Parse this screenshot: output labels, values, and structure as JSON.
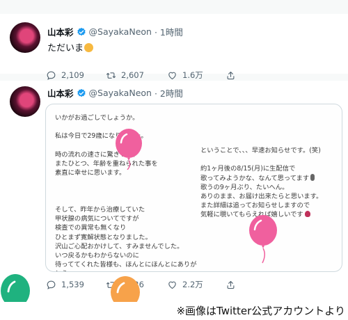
{
  "tweet1": {
    "name": "山本彩",
    "handle": "@SayakaNeon",
    "time": "· 1時間",
    "text": "ただいま",
    "emoji": "smiling-face-emoji",
    "stats": {
      "reply": "2,109",
      "retweet": "2,607",
      "like": "1.6万"
    }
  },
  "tweet2": {
    "name": "山本彩",
    "handle": "@SayakaNeon",
    "time": "· 2時間",
    "image_left": [
      "いかがお過ごしでしょうか。",
      "",
      "私は今日で29歳になりました。",
      "",
      "時の流れの速さに驚きつつ、",
      "またひとつ、年齢を重ねられた事を",
      "素直に幸せに思います。",
      "",
      "",
      "",
      "そして、昨年から治療していた",
      "甲状腺の病気についてですが",
      "検査での異常も無くなり",
      "ひとまず寛解状態となりました。",
      "沢山ご心配おかけして、すみませんでした。",
      "いつ戻るかもわからないのに",
      "待っててくれた皆様も、ほんとにほんとにありが",
      "とう。"
    ],
    "image_right": [
      "ということで、、、早速お知らせです。(笑)",
      "",
      "約1ヶ月後の8/15(月)に生配信で",
      "歌ってみようかな、なんて思ってます",
      "歌うの9ヶ月ぶり、たいへん。",
      "ありのまま、お届け出来たらと思います。",
      "また詳細は追ってお知らせしますので",
      "気軽に覗いてもらえれば嬉しいです"
    ],
    "stats": {
      "reply": "1,539",
      "retweet": "5,226",
      "like": "2.2万"
    }
  },
  "caption": "※画像はTwitter公式アカウントより",
  "colors": {
    "balloon_pink": "#f0609e",
    "balloon_orange": "#f7a24a",
    "balloon_green": "#1fb27f",
    "verified": "#1d9bf0"
  },
  "icons": [
    "reply-icon",
    "retweet-icon",
    "like-icon",
    "share-icon",
    "verified-badge-icon",
    "balloon-icon"
  ]
}
